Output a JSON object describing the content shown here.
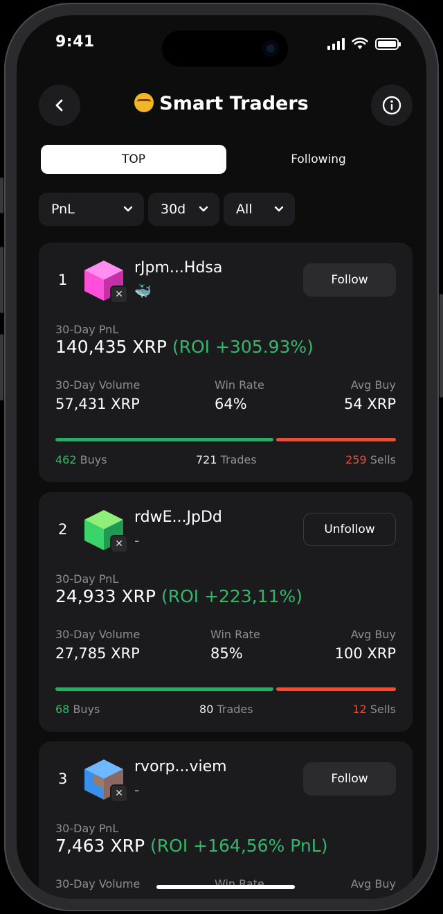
{
  "status": {
    "time": "9:41"
  },
  "header": {
    "title": "Smart Traders",
    "emoji": "nerd-face-emoji",
    "back_icon": "chevron-left-icon",
    "info_icon": "info-icon"
  },
  "tabs": [
    {
      "label": "TOP",
      "active": true
    },
    {
      "label": "Following",
      "active": false
    }
  ],
  "filters": {
    "metric": "PnL",
    "period": "30d",
    "scope": "All"
  },
  "labels": {
    "pnl": "30-Day PnL",
    "volume": "30-Day Volume",
    "win_rate": "Win Rate",
    "avg_buy": "Avg Buy",
    "buys": "Buys",
    "trades": "Trades",
    "sells": "Sells"
  },
  "colors": {
    "positive": "#34b76a",
    "negative": "#e5503b",
    "card": "#1b1b1d"
  },
  "traders": [
    {
      "rank": "1",
      "name": "rJpm...Hdsa",
      "tag": "🐳",
      "action": "Follow",
      "avatar_color": "#ff4fd8",
      "pnl": "140,435 XRP",
      "roi": "(ROI +305.93%)",
      "volume": "57,431 XRP",
      "win_rate": "64%",
      "avg_buy": "54 XRP",
      "buys": "462",
      "trades": "721",
      "sells": "259",
      "buy_share": 0.64
    },
    {
      "rank": "2",
      "name": "rdwE...JpDd",
      "tag": "-",
      "action": "Unfollow",
      "avatar_color": "#3bd46a",
      "pnl": "24,933 XRP",
      "roi": "(ROI +223,11%)",
      "volume": "27,785 XRP",
      "win_rate": "85%",
      "avg_buy": "100 XRP",
      "buys": "68",
      "trades": "80",
      "sells": "12",
      "buy_share": 0.64
    },
    {
      "rank": "3",
      "name": "rvorp...viem",
      "tag": "-",
      "action": "Follow",
      "avatar_color": "#3a8fe8",
      "pnl": "7,463 XRP",
      "roi": "(ROI +164,56% PnL)",
      "volume": "",
      "win_rate": "",
      "avg_buy": "",
      "buys": "",
      "trades": "",
      "sells": "",
      "buy_share": null
    }
  ]
}
